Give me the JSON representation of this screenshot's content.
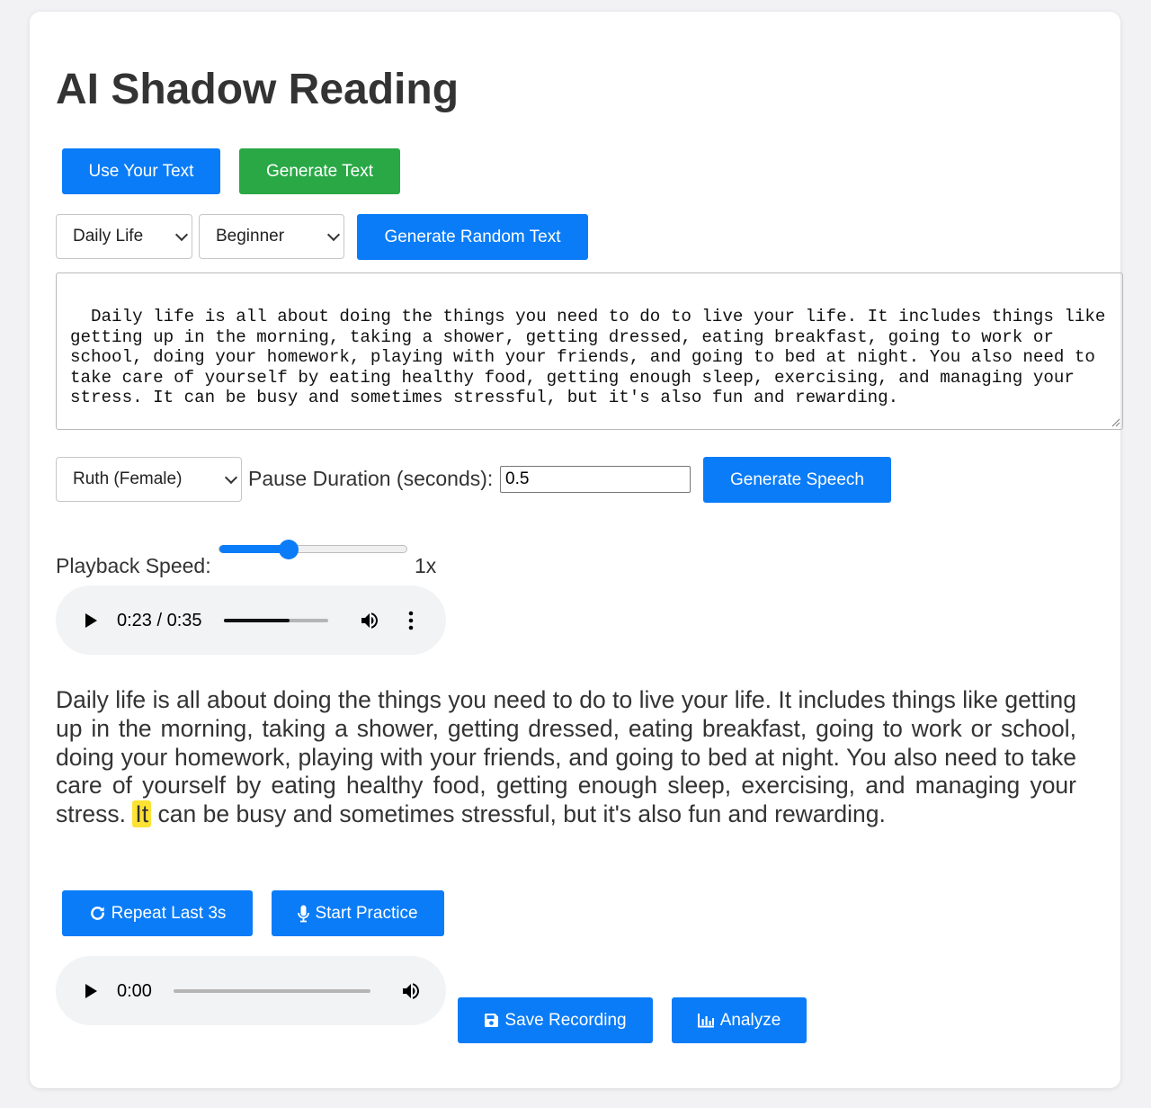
{
  "app": {
    "title": "AI Shadow Reading"
  },
  "mode_buttons": {
    "use_your_text": "Use Your Text",
    "generate_text": "Generate Text"
  },
  "generator": {
    "topic_selected": "Daily Life",
    "level_selected": "Beginner",
    "generate_random_label": "Generate Random Text"
  },
  "input_text": "Daily life is all about doing the things you need to do to live your life. It includes things like getting up in the morning, taking a shower, getting dressed, eating breakfast, going to work or school, doing your homework, playing with your friends, and going to bed at night. You also need to take care of yourself by eating healthy food, getting enough sleep, exercising, and managing your stress. It can be busy and sometimes stressful, but it's also fun and rewarding.",
  "speech": {
    "voice_selected": "Ruth (Female)",
    "pause_label": "Pause Duration (seconds):",
    "pause_value": "0.5",
    "generate_label": "Generate Speech"
  },
  "playback": {
    "label": "Playback Speed:",
    "speed_text": "1x",
    "slider_fraction": 0.37
  },
  "main_player": {
    "time": "0:23 / 0:35",
    "progress_fraction": 0.63
  },
  "reading": {
    "words_before": "Daily life is all about doing the things you need to do to live your life. It includes things like getting up in the morning, taking a shower, getting dressed, eating breakfast, going to work or school, doing your homework, playing with your friends, and going to bed at night. You also need to take care of yourself by eating healthy food, getting enough sleep, exercising, and managing your stress.",
    "highlighted_word": "It",
    "words_after": "can be busy and sometimes stressful, but it's also fun and rewarding.",
    "highlight_color": "#fbe233"
  },
  "practice": {
    "repeat_label": "Repeat Last 3s",
    "start_label": "Start Practice"
  },
  "recording_player": {
    "time": "0:00",
    "progress_fraction": 0.0
  },
  "actions": {
    "save_label": "Save Recording",
    "analyze_label": "Analyze"
  },
  "colors": {
    "primary": "#0a7cf7",
    "success": "#2aa846"
  }
}
